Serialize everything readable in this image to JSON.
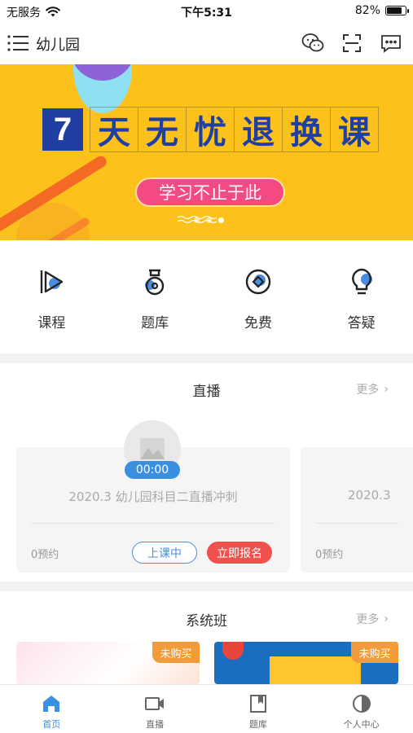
{
  "status_bar": {
    "carrier": "无服务",
    "time": "下午5:31",
    "battery_text": "82%",
    "battery_level": 0.82
  },
  "nav": {
    "title": "幼儿园",
    "icons": [
      "menu-icon",
      "wechat-icon",
      "scan-icon",
      "message-icon"
    ]
  },
  "banner": {
    "number": "7",
    "headline_chars": [
      "天",
      "无",
      "忧",
      "退",
      "换",
      "课"
    ],
    "slogan": "学习不止于此",
    "dot_count": 3,
    "active_dot": 2,
    "colors": {
      "background": "#fcc21b",
      "headline": "#1f3fa3",
      "slogan_bg": "#f34a82"
    }
  },
  "quick_nav": [
    {
      "label": "课程",
      "icon": "play-course-icon"
    },
    {
      "label": "题库",
      "icon": "question-bank-icon"
    },
    {
      "label": "免费",
      "icon": "free-coin-icon"
    },
    {
      "label": "答疑",
      "icon": "lightbulb-icon"
    }
  ],
  "live_section": {
    "title": "直播",
    "more": "更多",
    "cards": [
      {
        "timer": "00:00",
        "title": "2020.3 幼儿园科目二直播冲刺",
        "count": "0预约",
        "status_button": "上课中",
        "signup_button": "立即报名"
      },
      {
        "title": "2020.3",
        "count": "0预约"
      }
    ]
  },
  "system_section": {
    "title": "系统班",
    "more": "更多",
    "cards": [
      {
        "tag": "未购买"
      },
      {
        "tag": "未购买"
      }
    ]
  },
  "tab_bar": [
    {
      "label": "首页",
      "icon": "home-icon",
      "active": true
    },
    {
      "label": "直播",
      "icon": "video-camera-icon",
      "active": false
    },
    {
      "label": "题库",
      "icon": "bookmark-icon",
      "active": false
    },
    {
      "label": "个人中心",
      "icon": "profile-icon",
      "active": false
    }
  ],
  "colors": {
    "accent": "#3a8fe0",
    "danger": "#f0514e",
    "tag": "#f19b3a"
  }
}
